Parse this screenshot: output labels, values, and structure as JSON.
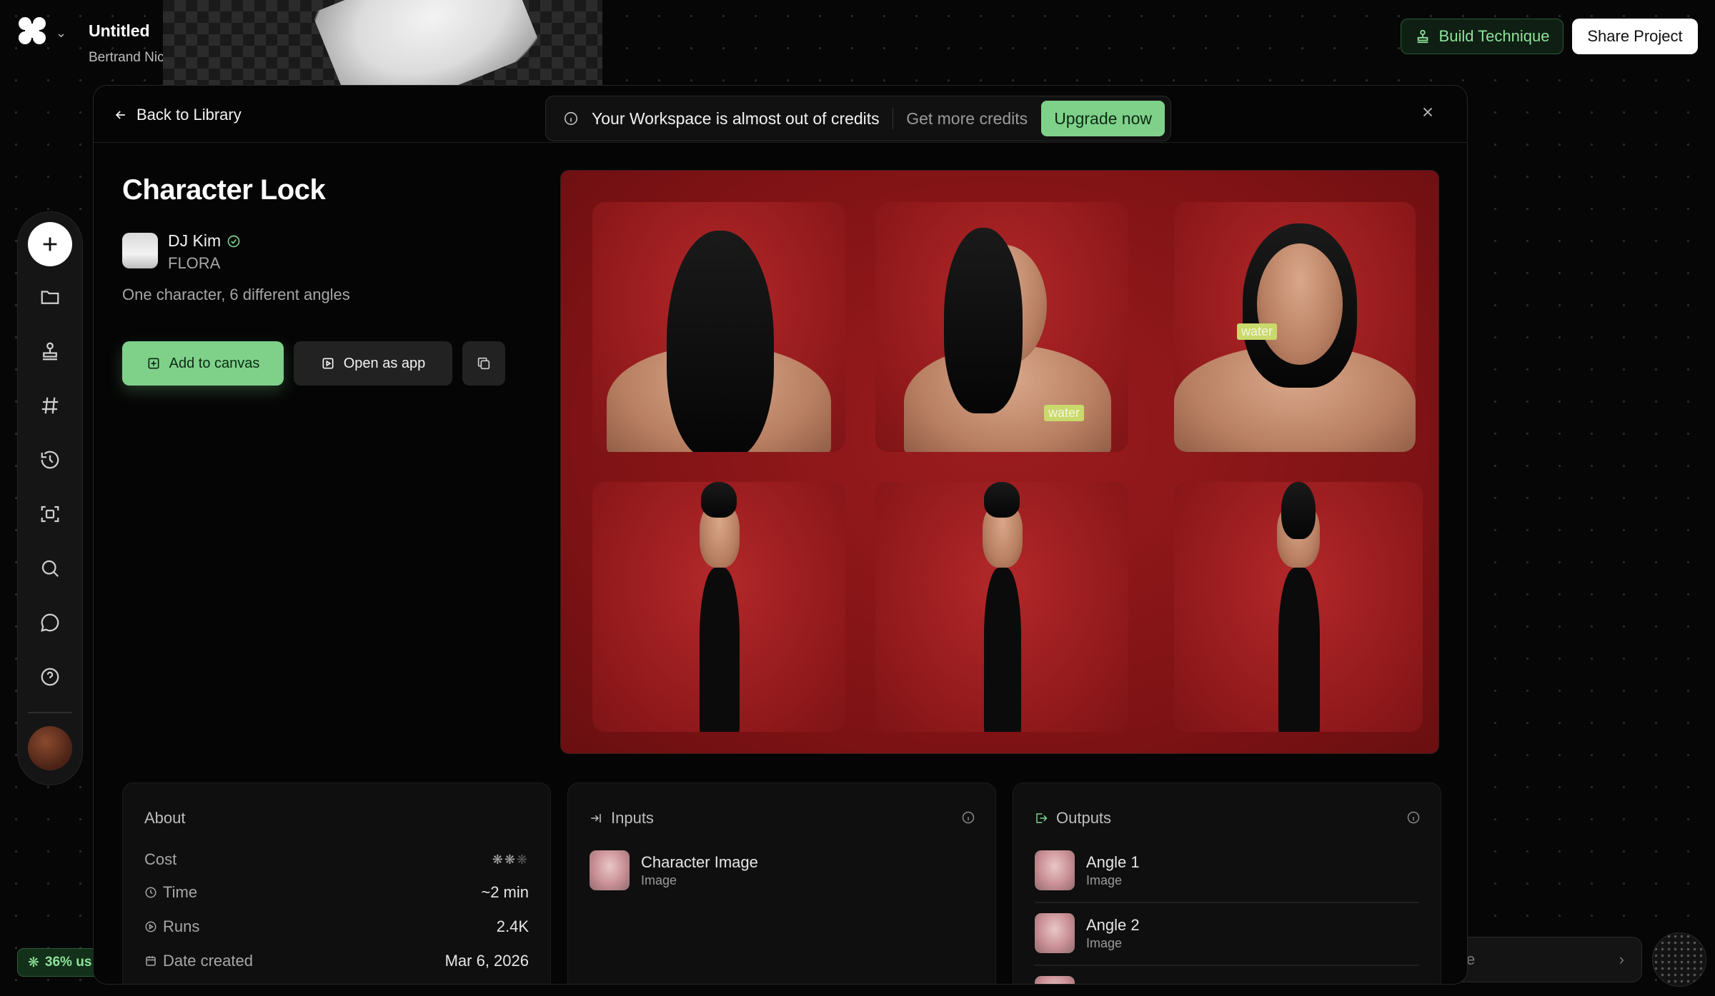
{
  "app": {
    "project_title": "Untitled",
    "workspace": "Bertrand Nicelydone's workspace"
  },
  "header_actions": {
    "build_label": "Build Technique",
    "share_label": "Share Project"
  },
  "toolbar": {
    "items": [
      "add",
      "files",
      "techniques",
      "hashtag",
      "history",
      "scan",
      "search",
      "chat",
      "help"
    ]
  },
  "usage": {
    "label": "36% us"
  },
  "chat_bar": {
    "placeholder_fragment": "ve"
  },
  "modal": {
    "back_label": "Back to Library",
    "banner": {
      "message": "Your Workspace is almost out of credits",
      "more_label": "Get more credits",
      "upgrade_label": "Upgrade now"
    }
  },
  "technique": {
    "title": "Character Lock",
    "author": "DJ Kim",
    "org": "FLORA",
    "description": "One character, 6 different angles",
    "add_label": "Add to canvas",
    "open_label": "Open as app",
    "water_tag": "water"
  },
  "about": {
    "title": "About",
    "rows": [
      {
        "label": "Cost",
        "value": ""
      },
      {
        "label": "Time",
        "value": "~2 min"
      },
      {
        "label": "Runs",
        "value": "2.4K"
      },
      {
        "label": "Date created",
        "value": "Mar 6, 2026"
      }
    ]
  },
  "inputs": {
    "title": "Inputs",
    "items": [
      {
        "name": "Character Image",
        "type": "Image"
      }
    ]
  },
  "outputs": {
    "title": "Outputs",
    "items": [
      {
        "name": "Angle 1",
        "type": "Image"
      },
      {
        "name": "Angle 2",
        "type": "Image"
      }
    ]
  },
  "colors": {
    "accent_green": "#7fd18a",
    "preview_red": "#8f1719",
    "background": "#060606"
  }
}
